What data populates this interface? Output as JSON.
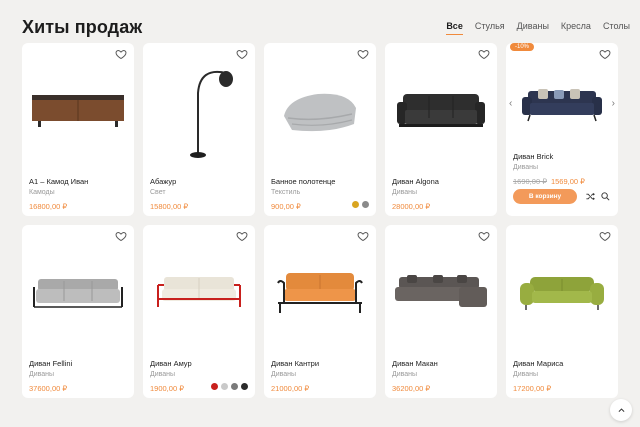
{
  "header": {
    "title": "Хиты продаж",
    "tabs": [
      "Все",
      "Стулья",
      "Диваны",
      "Кресла",
      "Столы"
    ]
  },
  "products": [
    {
      "name": "А1 – Камод Иван",
      "category": "Камоды",
      "price": "16800,00 ₽"
    },
    {
      "name": "Абажур",
      "category": "Свет",
      "price": "15800,00 ₽"
    },
    {
      "name": "Банное полотенце",
      "category": "Текстиль",
      "price": "900,00 ₽",
      "swatches": [
        "#d9a521",
        "#8a8a8a"
      ]
    },
    {
      "name": "Диван Algona",
      "category": "Диваны",
      "price": "28000,00 ₽"
    },
    {
      "name": "Диван Brick",
      "category": "Диваны",
      "old_price": "1690,00 ₽",
      "price": "1569,00 ₽",
      "badge": "-10%",
      "cart_label": "В корзину"
    },
    {
      "name": "Диван Fellini",
      "category": "Диваны",
      "price": "37600,00 ₽"
    },
    {
      "name": "Диван Амур",
      "category": "Диваны",
      "price": "1900,00 ₽",
      "swatches": [
        "#c8201d",
        "#c9c9c9",
        "#7a7a7a",
        "#2b2b2b"
      ]
    },
    {
      "name": "Диван Кантри",
      "category": "Диваны",
      "price": "21000,00 ₽"
    },
    {
      "name": "Диван Макан",
      "category": "Диваны",
      "price": "36200,00 ₽"
    },
    {
      "name": "Диван Мариса",
      "category": "Диваны",
      "price": "17200,00 ₽"
    }
  ],
  "colors": {
    "accent": "#f08a3c",
    "background": "#f2f1ef"
  },
  "icons": [
    "heart-icon",
    "shuffle-icon",
    "search-icon",
    "chevron-up-icon",
    "chevron-left-icon",
    "chevron-right-icon"
  ]
}
